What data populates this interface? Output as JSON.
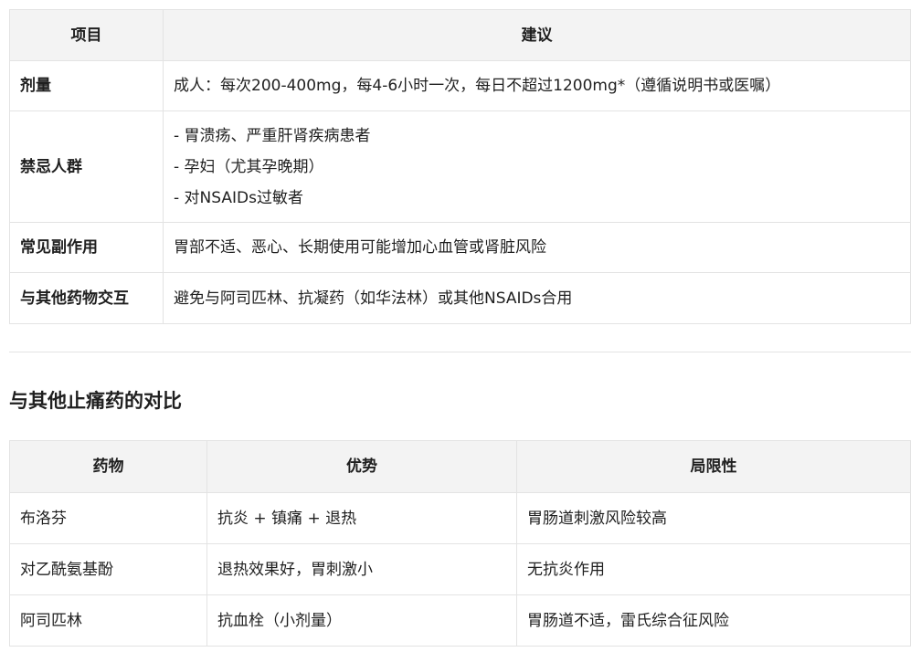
{
  "table1": {
    "headers": [
      "项目",
      "建议"
    ],
    "rows": [
      {
        "item": "剂量",
        "advice": [
          "成人：每次200-400mg，每4-6小时一次，每日不超过1200mg*（遵循说明书或医嘱）"
        ]
      },
      {
        "item": "禁忌人群",
        "advice": [
          "- 胃溃疡、严重肝肾疾病患者",
          "- 孕妇（尤其孕晚期）",
          "- 对NSAIDs过敏者"
        ]
      },
      {
        "item": "常见副作用",
        "advice": [
          "胃部不适、恶心、长期使用可能增加心血管或肾脏风险"
        ]
      },
      {
        "item": "与其他药物交互",
        "advice": [
          "避免与阿司匹林、抗凝药（如华法林）或其他NSAIDs合用"
        ]
      }
    ]
  },
  "section_heading": "与其他止痛药的对比",
  "table2": {
    "headers": [
      "药物",
      "优势",
      "局限性"
    ],
    "rows": [
      [
        "布洛芬",
        "抗炎 + 镇痛 + 退热",
        "胃肠道刺激风险较高"
      ],
      [
        "对乙酰氨基酚",
        "退热效果好，胃刺激小",
        "无抗炎作用"
      ],
      [
        "阿司匹林",
        "抗血栓（小剂量）",
        "胃肠道不适，雷氏综合征风险"
      ]
    ]
  }
}
